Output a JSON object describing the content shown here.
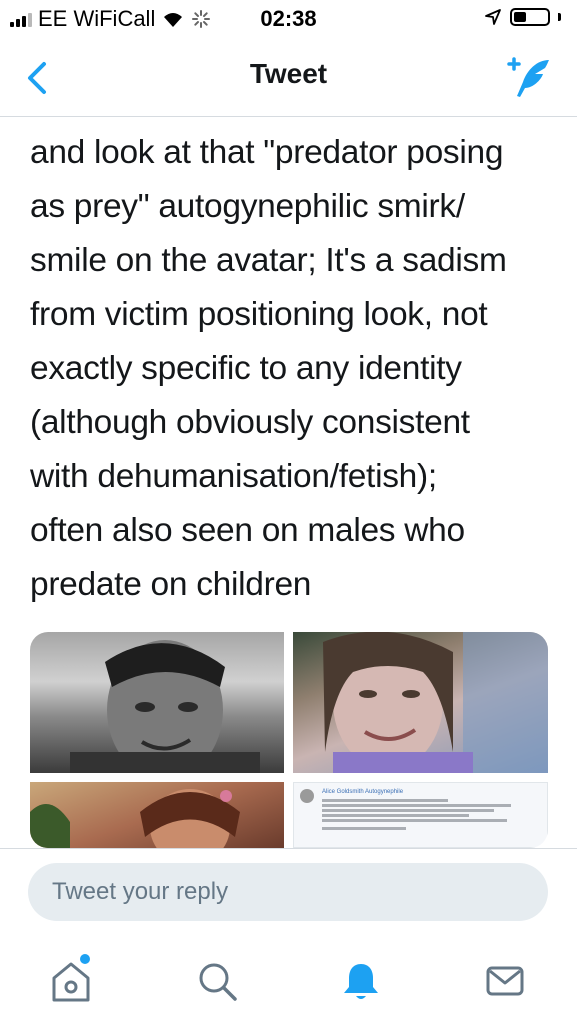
{
  "status_bar": {
    "carrier": "EE WiFiCall",
    "time": "02:38"
  },
  "nav": {
    "title": "Tweet"
  },
  "tweet": {
    "text": "and look at that \"predator posing\nas prey\" autogynephilic smirk/\nsmile on the avatar;  It's a sadism\nfrom victim positioning look, not\nexactly specific to any identity\n(although obviously consistent\nwith dehumanisation/fetish);\noften also seen on males who\npredate on children"
  },
  "media": {
    "screenshot_author": "Alice Goldsmith Autogynephile"
  },
  "reply": {
    "placeholder": "Tweet your reply"
  },
  "colors": {
    "accent": "#1da1f2",
    "icon_gray": "#657786",
    "reply_bg": "#e6ecf0"
  },
  "tabs": [
    {
      "icon": "home-icon",
      "active": false,
      "has_notification_dot": true
    },
    {
      "icon": "search-icon",
      "active": false
    },
    {
      "icon": "bell-icon",
      "active": true
    },
    {
      "icon": "mail-icon",
      "active": false
    }
  ]
}
